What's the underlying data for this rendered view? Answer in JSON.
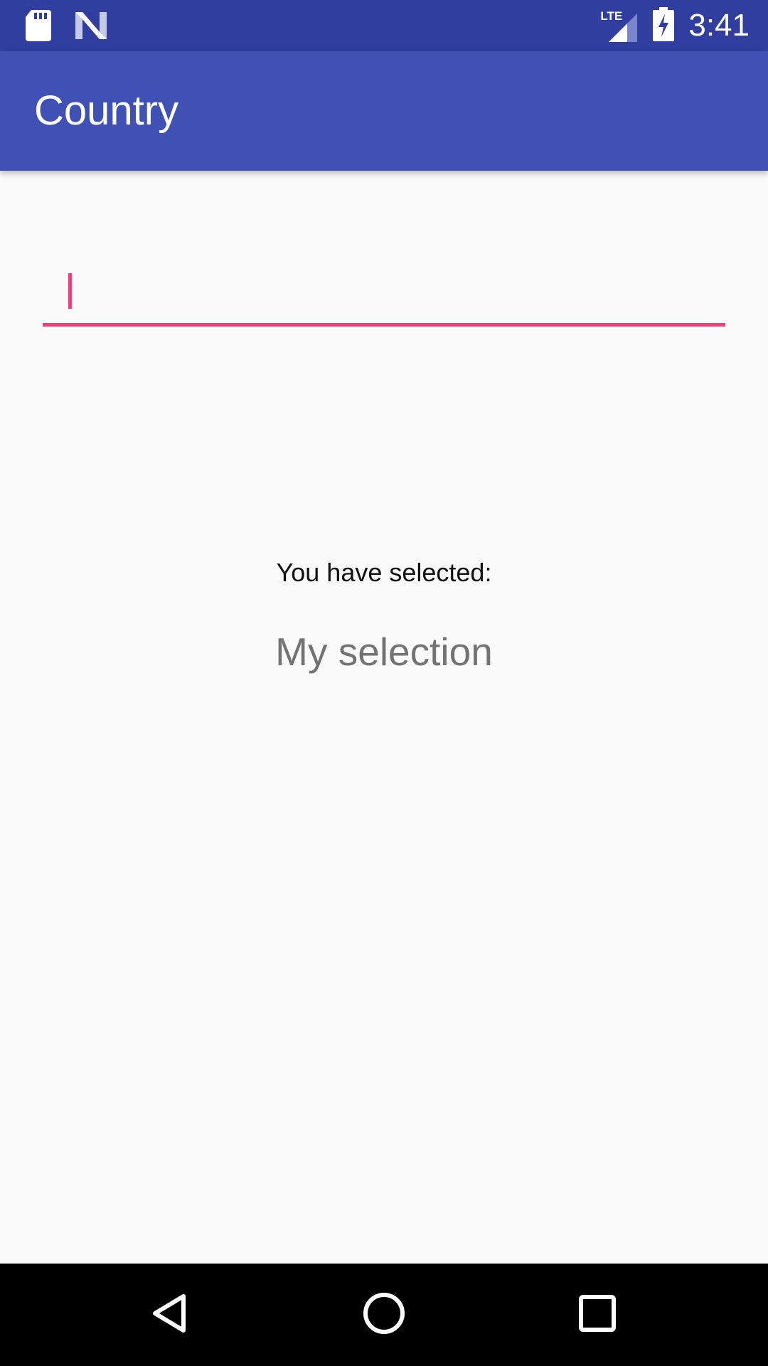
{
  "status_bar": {
    "time": "3:41",
    "network_label": "LTE",
    "icons": [
      "sd-card-icon",
      "n-logo-icon",
      "lte-signal-icon",
      "battery-charging-icon"
    ],
    "background": "#303f9f"
  },
  "app_bar": {
    "title": "Country",
    "background": "#3f51b5"
  },
  "country_field": {
    "value": "",
    "accent_color": "#ec407a"
  },
  "selection": {
    "label": "You have selected:",
    "value": "My selection"
  },
  "nav_bar": {
    "buttons": [
      "back-icon",
      "home-icon",
      "recents-icon"
    ]
  }
}
